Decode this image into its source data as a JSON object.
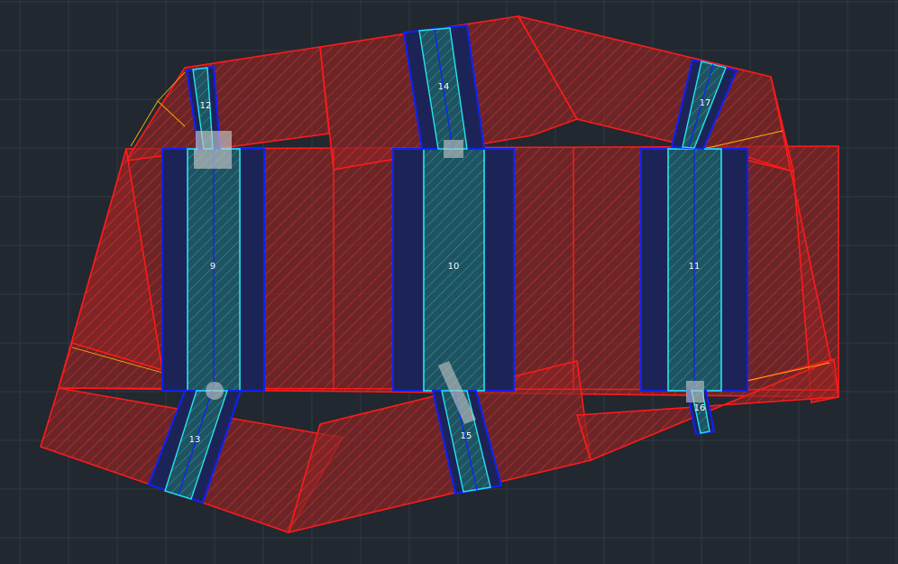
{
  "colors": {
    "background": "#212830",
    "grid": "#2f3945",
    "zone_outline": "#ff1a1a",
    "zone_fill": "#8a2424",
    "hatch_stroke": "#ff3a3a",
    "footing_outline": "#1020ff",
    "footing_fill": "#1c2457",
    "column_outline": "#22e6ee",
    "column_fill": "#205c63",
    "yellow_line": "#ffb000",
    "marker_fill": "#c8c8c8"
  },
  "labels": [
    "9",
    "10",
    "11",
    "12",
    "13",
    "14",
    "15",
    "16",
    "17"
  ]
}
